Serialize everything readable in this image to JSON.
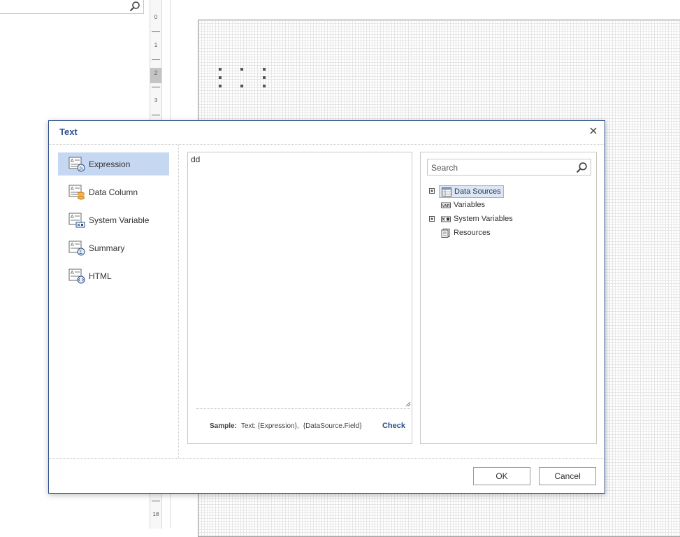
{
  "ruler": {
    "marks": [
      "0",
      "1",
      "2",
      "3",
      "18"
    ]
  },
  "dialog": {
    "title": "Text",
    "nav": [
      {
        "label": "Expression",
        "icon": "expression-icon",
        "active": true
      },
      {
        "label": "Data Column",
        "icon": "data-column-icon",
        "active": false
      },
      {
        "label": "System Variable",
        "icon": "system-variable-icon",
        "active": false
      },
      {
        "label": "Summary",
        "icon": "summary-icon",
        "active": false
      },
      {
        "label": "HTML",
        "icon": "html-icon",
        "active": false
      }
    ],
    "expression": {
      "value": "dd",
      "sample_label": "Sample:",
      "sample_text": "Text: {Expression},",
      "sample_field": "{DataSource.Field}",
      "check_label": "Check"
    },
    "dictionary": {
      "search_placeholder": "Search",
      "tree": [
        {
          "label": "Data Sources",
          "icon": "data-sources-icon",
          "expandable": true,
          "selected": true
        },
        {
          "label": "Variables",
          "icon": "variables-icon",
          "expandable": false,
          "selected": false
        },
        {
          "label": "System Variables",
          "icon": "system-variables-icon",
          "expandable": true,
          "selected": false
        },
        {
          "label": "Resources",
          "icon": "resources-icon",
          "expandable": false,
          "selected": false
        }
      ]
    },
    "buttons": {
      "ok": "OK",
      "cancel": "Cancel"
    }
  },
  "colors": {
    "accent": "#2a4e8c",
    "selection": "#c5d7f1"
  }
}
